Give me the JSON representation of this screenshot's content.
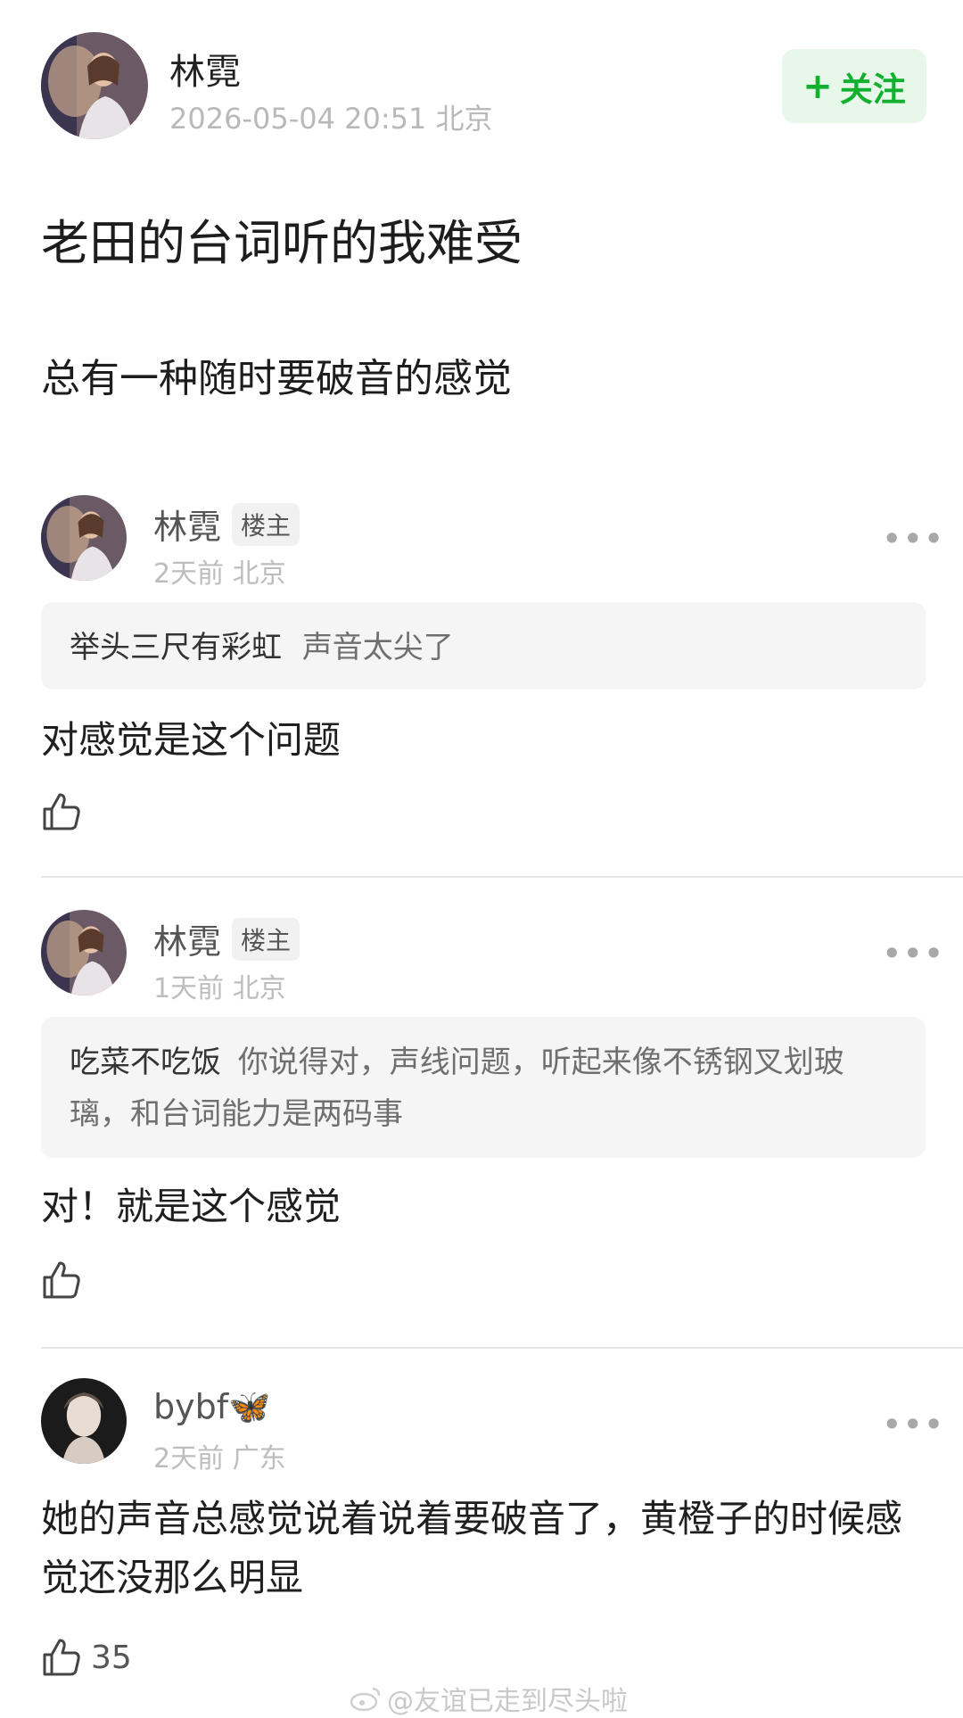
{
  "post": {
    "author": "林霓",
    "timestamp": "2026-05-04 20:51 北京",
    "follow_label": "关注",
    "title": "老田的台词听的我难受",
    "body": "总有一种随时要破音的感觉"
  },
  "comments": [
    {
      "author": "林霓",
      "badge": "楼主",
      "time": "2天前 北京",
      "quote_user": "举头三尺有彩虹",
      "quote_text": "声音太尖了",
      "text": "对感觉是这个问题",
      "likes": ""
    },
    {
      "author": "林霓",
      "badge": "楼主",
      "time": "1天前 北京",
      "quote_user": "吃菜不吃饭",
      "quote_text": "你说得对，声线问题，听起来像不锈钢叉划玻璃，和台词能力是两码事",
      "text": "对！就是这个感觉",
      "likes": ""
    },
    {
      "author": "bybf🦋",
      "time": "2天前 广东",
      "text": "她的声音总感觉说着说着要破音了，黄橙子的时候感觉还没那么明显",
      "likes": "35"
    }
  ],
  "watermark": "@友谊已走到尽头啦",
  "colors": {
    "accent_green": "#13b02f",
    "follow_bg": "#e7f7ea",
    "quote_bg": "#f5f5f5",
    "meta_gray": "#b9b9b9"
  }
}
